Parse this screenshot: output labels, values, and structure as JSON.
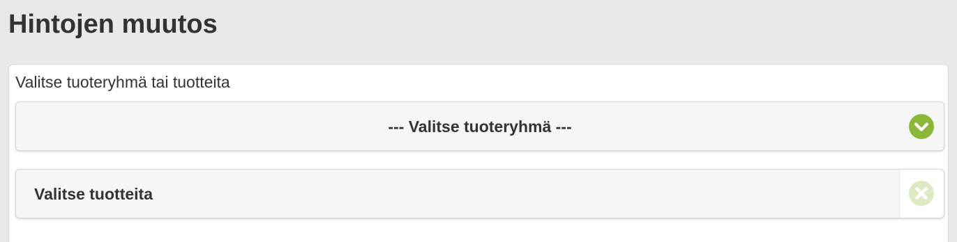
{
  "header": {
    "title": "Hintojen muutos"
  },
  "form": {
    "label": "Valitse tuoteryhmä tai tuotteita",
    "product_group_select": {
      "selected": "--- Valitse tuoteryhmä ---",
      "icon": "chevron-down-icon",
      "icon_color": "#8cb83a"
    },
    "products_select": {
      "placeholder": "Valitse tuotteita",
      "icon": "close-icon",
      "icon_color": "#dce9c3"
    }
  }
}
